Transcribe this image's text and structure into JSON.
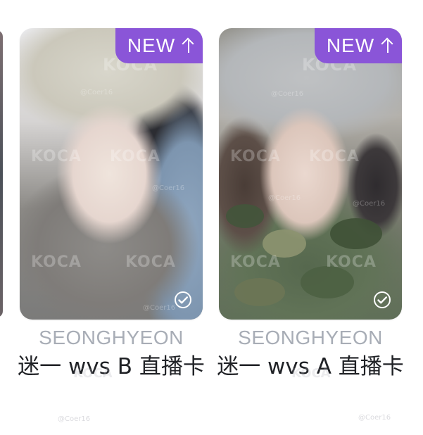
{
  "cards": [
    {
      "badge": "NEW",
      "badge_icon": "arrow-up-icon",
      "member": "SEONGHYEON",
      "title": "迷一 wvs B 直播卡",
      "watermark": "KOCA",
      "credit": "@Coer16",
      "collected_icon": "check-circle-icon"
    },
    {
      "badge": "NEW",
      "badge_icon": "arrow-up-icon",
      "member": "SEONGHYEON",
      "title": "迷一 wvs A 直播卡",
      "watermark": "KOCA",
      "credit": "@Coer16",
      "collected_icon": "check-circle-icon"
    }
  ],
  "colors": {
    "badge_purple": "#8a55d8",
    "member_gray": "#a8adb6",
    "title_text": "#202226"
  }
}
